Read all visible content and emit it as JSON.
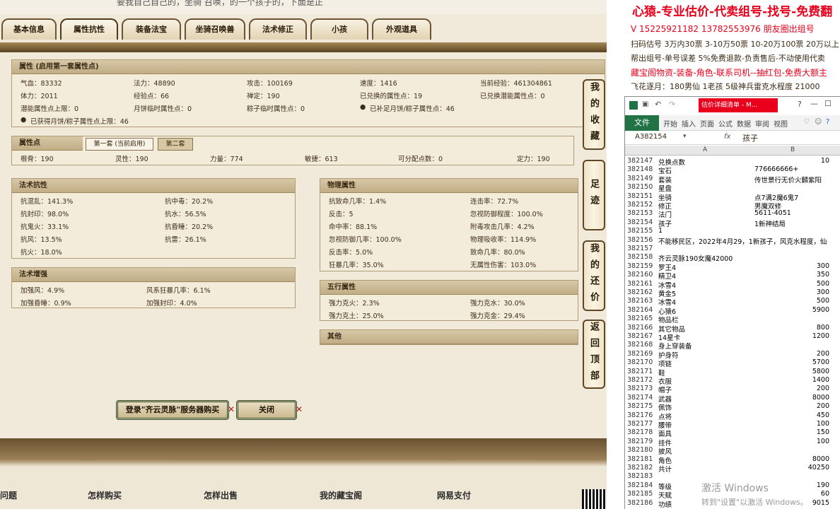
{
  "game": {
    "top_text": "要我自己自己的，坐骑 召唤，的一个孩子的，下面是正",
    "tabs": [
      "基本信息",
      "属性抗性",
      "装备法宝",
      "坐骑召唤兽",
      "法术修正",
      "小孩",
      "外观道具"
    ],
    "active_tab": "属性抗性",
    "attributes": {
      "title": "属性 (启用第一套属性点)",
      "rows": [
        [
          "气血：83332",
          "法力：48890",
          "攻击：100169",
          "速度：1416",
          "当前经验：461304861"
        ],
        [
          "体力：2011",
          "经验点：66",
          "禅定：190",
          "已兑换的属性点：19",
          "已兑换潜能属性点：0"
        ],
        [
          "潜能属性点上限：0",
          "月饼临时属性点：0",
          "粽子临时属性点：0",
          "已补足月饼/粽子属性点：46",
          ""
        ]
      ],
      "last": "已获得月饼/粽子属性点上限：46"
    },
    "attr_points": {
      "title": "属性点",
      "subtabs": [
        "第一套 (当前启用)",
        "第二套"
      ],
      "values": [
        "根骨：190",
        "灵性：190",
        "力量：774",
        "敏捷：613",
        "可分配点数：0",
        "定力：190"
      ]
    },
    "spell_resist": {
      "title": "法术抗性",
      "rows": [
        [
          "抗混乱：141.3%",
          "抗中毒：20.2%"
        ],
        [
          "抗封印：98.0%",
          "抗水：56.5%"
        ],
        [
          "抗鬼火：33.1%",
          "抗昏睡：20.2%"
        ],
        [
          "抗风：13.5%",
          "抗雷：26.1%"
        ],
        [
          "抗火：18.0%",
          ""
        ]
      ]
    },
    "spell_boost": {
      "title": "法术增强",
      "rows": [
        [
          "加强风：4.9%",
          "风系狂暴几率：6.1%"
        ],
        [
          "加强昏睡：0.9%",
          "加强封印：4.0%"
        ]
      ]
    },
    "physical": {
      "title": "物理属性",
      "rows": [
        [
          "抗致命几率：1.4%",
          "连击率：72.7%"
        ],
        [
          "反击：5",
          "忽视防御程度：100.0%"
        ],
        [
          "命中率：88.1%",
          "附毒攻击几率：4.2%"
        ],
        [
          "忽视防御几率：100.0%",
          "物理吸收率：114.9%"
        ],
        [
          "反击率：5.0%",
          "致命几率：80.0%"
        ],
        [
          "狂暴几率：35.0%",
          "无属性伤害：103.0%"
        ]
      ]
    },
    "five_elements": {
      "title": "五行属性",
      "rows": [
        [
          "强力克火：2.3%",
          "强力克水：30.0%"
        ],
        [
          "强力克土：25.0%",
          "强力克金：29.4%"
        ]
      ]
    },
    "other": {
      "title": "其他"
    },
    "side_buttons": [
      "我的收藏",
      "足迹",
      "我的还价",
      "返回顶部"
    ],
    "buy_button": "登录\"齐云灵脉\"服务器购买",
    "close_button": "关闭",
    "footer_links": [
      "问题",
      "怎样购买",
      "怎样出售",
      "我的藏宝阁",
      "网易支付"
    ]
  },
  "ad": {
    "title": "心猿-专业估价-代卖组号-找号-免费翻",
    "lines": [
      {
        "text": "V 15225921182   13782553976 朋友圈出组号",
        "color": "#e8001c"
      },
      {
        "text": "扫码估号 3万内30票 3-10万50票 10-20万100票 20万以上1",
        "color": "#111"
      },
      {
        "text": "帮出组号-单号误差 5%免费退款-负责售后-不动使用代卖",
        "color": "#111"
      },
      {
        "text": "藏宝阁物资-装备-角色-联系司机--抽红包-免费大额主",
        "color": "#e8001c"
      },
      {
        "text": "飞花逐月：180男仙 1老孩 5级神兵雷克水程度 21000",
        "color": "#111"
      }
    ]
  },
  "excel": {
    "title": "估价详细清单 - M...",
    "file": "文件",
    "ribbon": [
      "开始",
      "插入",
      "页面",
      "公式",
      "数据",
      "审阅",
      "视图"
    ],
    "namebox": "A382154",
    "fx": "fx",
    "formula": "孩子",
    "cols": [
      "A",
      "B"
    ],
    "rows": [
      [
        "382147",
        "兑换点数",
        "10"
      ],
      [
        "382148",
        "宝石",
        "776666666+"
      ],
      [
        "382149",
        "套装",
        "传世景行无价火麟紫阳"
      ],
      [
        "382150",
        "星盘",
        ""
      ],
      [
        "382151",
        "坐骑",
        "点7满2魔6鬼7"
      ],
      [
        "382152",
        "修正",
        "男魔双修"
      ],
      [
        "382153",
        "法门",
        "5611-4051"
      ],
      [
        "382154",
        "孩子",
        "1新神结局"
      ],
      [
        "382155",
        "1",
        ""
      ],
      [
        "382156",
        "不能移民区，2022年4月29，1新孩子，风克水程度，仙",
        ""
      ],
      [
        "382157",
        "",
        ""
      ],
      [
        "382158",
        "齐云灵脉190女魔42000",
        ""
      ],
      [
        "382159",
        "罗王4",
        "300"
      ],
      [
        "382160",
        "精卫4",
        "350"
      ],
      [
        "382161",
        "冰雪4",
        "500"
      ],
      [
        "382162",
        "黄金5",
        "300"
      ],
      [
        "382163",
        "冰雪4",
        "500"
      ],
      [
        "382164",
        "心猿6",
        "5900"
      ],
      [
        "382165",
        "物品栏",
        ""
      ],
      [
        "382166",
        "其它物品",
        "800"
      ],
      [
        "382167",
        "14星卡",
        "1200"
      ],
      [
        "382168",
        "身上穿装备",
        ""
      ],
      [
        "382169",
        "护身符",
        "200"
      ],
      [
        "382170",
        "项链",
        "5700"
      ],
      [
        "382171",
        "鞋",
        "5800"
      ],
      [
        "382172",
        "衣服",
        "1400"
      ],
      [
        "382173",
        "帽子",
        "200"
      ],
      [
        "382174",
        "武器",
        "8000"
      ],
      [
        "382175",
        "佩饰",
        "200"
      ],
      [
        "382176",
        "点将",
        "450"
      ],
      [
        "382177",
        "腰带",
        "100"
      ],
      [
        "382178",
        "面具",
        "150"
      ],
      [
        "382179",
        "挂件",
        "100"
      ],
      [
        "382180",
        "披风",
        ""
      ],
      [
        "382181",
        "角色",
        "8000"
      ],
      [
        "382182",
        "共计",
        "40250"
      ],
      [
        "382183",
        "",
        ""
      ],
      [
        "382184",
        "等级",
        "190"
      ],
      [
        "382185",
        "天赋",
        "60"
      ],
      [
        "382186",
        "功绩",
        "9015"
      ]
    ]
  },
  "watermark": {
    "line1": "激活 Windows",
    "line2": "转到\"设置\"以激活 Windows。"
  }
}
